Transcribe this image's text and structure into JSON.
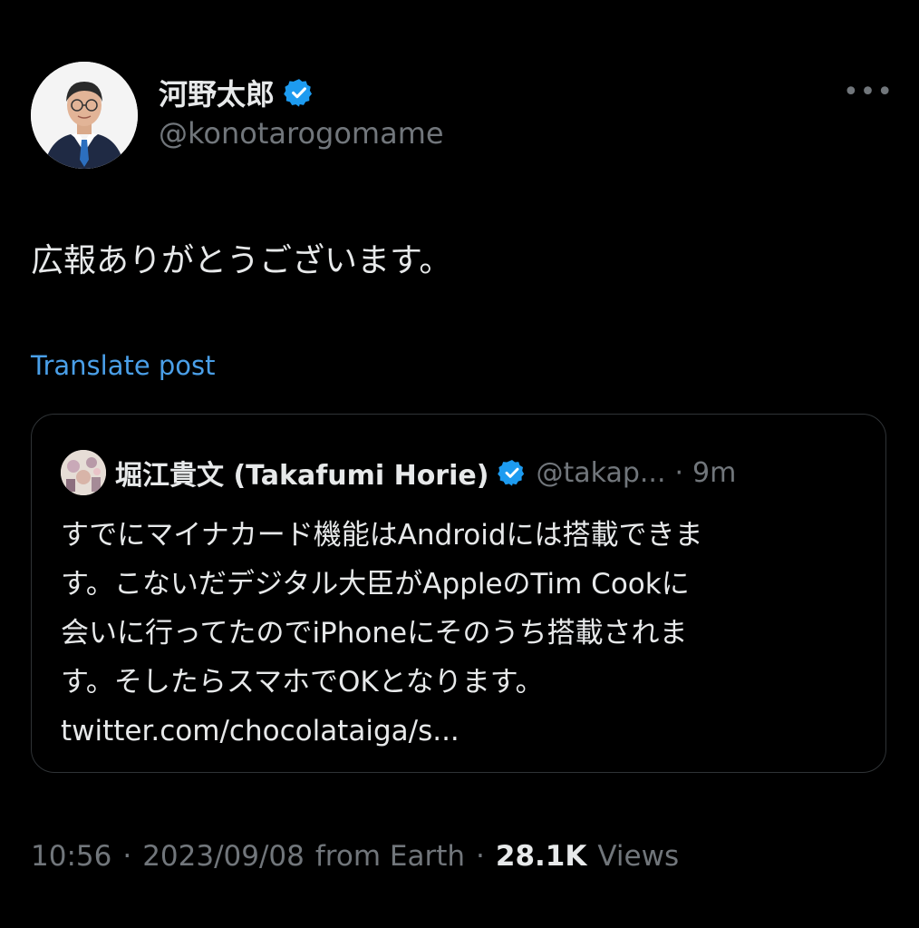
{
  "author": {
    "display_name": "河野太郎",
    "handle": "@konotarogomame",
    "verified": true,
    "avatar_icon": "profile-photo"
  },
  "more_icon_glyph": "•••",
  "post": {
    "text": "広報ありがとうございます。",
    "translate_label": "Translate post"
  },
  "quoted_post": {
    "display_name": "堀江貴文 (Takafumi Horie)",
    "handle": "@takap...",
    "separator": "·",
    "time": "9m",
    "lines": [
      "すでにマイナカード機能はAndroidには搭載できま",
      "す。こないだデジタル大臣がAppleのTim Cookに",
      "会いに行ってたのでiPhoneにそのうち搭載されま",
      "す。そしたらスマホでOKとなります。"
    ],
    "link": "twitter.com/chocolataiga/s..."
  },
  "meta": {
    "time": "10:56",
    "sep1": "·",
    "date": "2023/09/08",
    "source": "from Earth",
    "sep2": "·",
    "views_count": "28.1K",
    "views_label": "Views"
  },
  "colors": {
    "background": "#000000",
    "text_primary": "#e7e9ea",
    "text_secondary": "#71767b",
    "link_blue": "#4a9fe8",
    "verified_blue": "#1d9bf0",
    "border": "#2f3336"
  }
}
